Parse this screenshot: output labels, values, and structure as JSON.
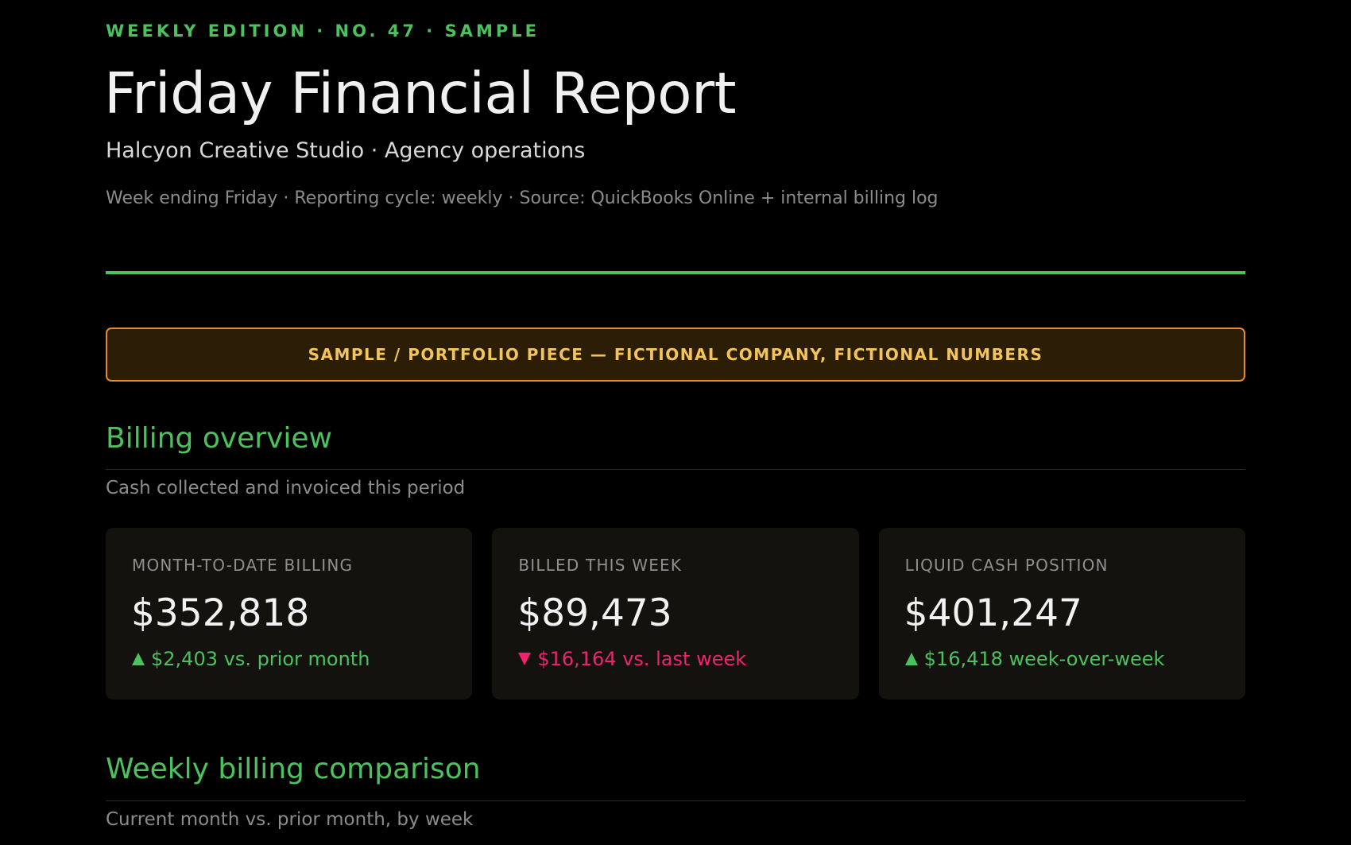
{
  "header": {
    "kicker": "WEEKLY EDITION · NO. 47 · SAMPLE",
    "title": "Friday Financial Report",
    "subtitle": "Halcyon Creative Studio · Agency operations",
    "meta": "Week ending Friday · Reporting cycle: weekly · Source: QuickBooks Online + internal billing log"
  },
  "notice": {
    "text": "SAMPLE / PORTFOLIO PIECE — FICTIONAL COMPANY, FICTIONAL NUMBERS"
  },
  "billing_overview": {
    "title": "Billing overview",
    "subtitle": "Cash collected and invoiced this period",
    "cards": [
      {
        "label": "MONTH-TO-DATE BILLING",
        "value": "$352,818",
        "delta": "$2,403 vs. prior month",
        "direction": "up"
      },
      {
        "label": "BILLED THIS WEEK",
        "value": "$89,473",
        "delta": "$16,164 vs. last week",
        "direction": "down"
      },
      {
        "label": "LIQUID CASH POSITION",
        "value": "$401,247",
        "delta": "$16,418 week-over-week",
        "direction": "up"
      }
    ]
  },
  "weekly_comparison": {
    "title": "Weekly billing comparison",
    "subtitle": "Current month vs. prior month, by week"
  },
  "colors": {
    "accent": "#4cc25e",
    "negative": "#f0246e",
    "warning_border": "#e98a2a",
    "warning_text": "#f3c45a",
    "background": "#000000",
    "card": "#13120e"
  }
}
